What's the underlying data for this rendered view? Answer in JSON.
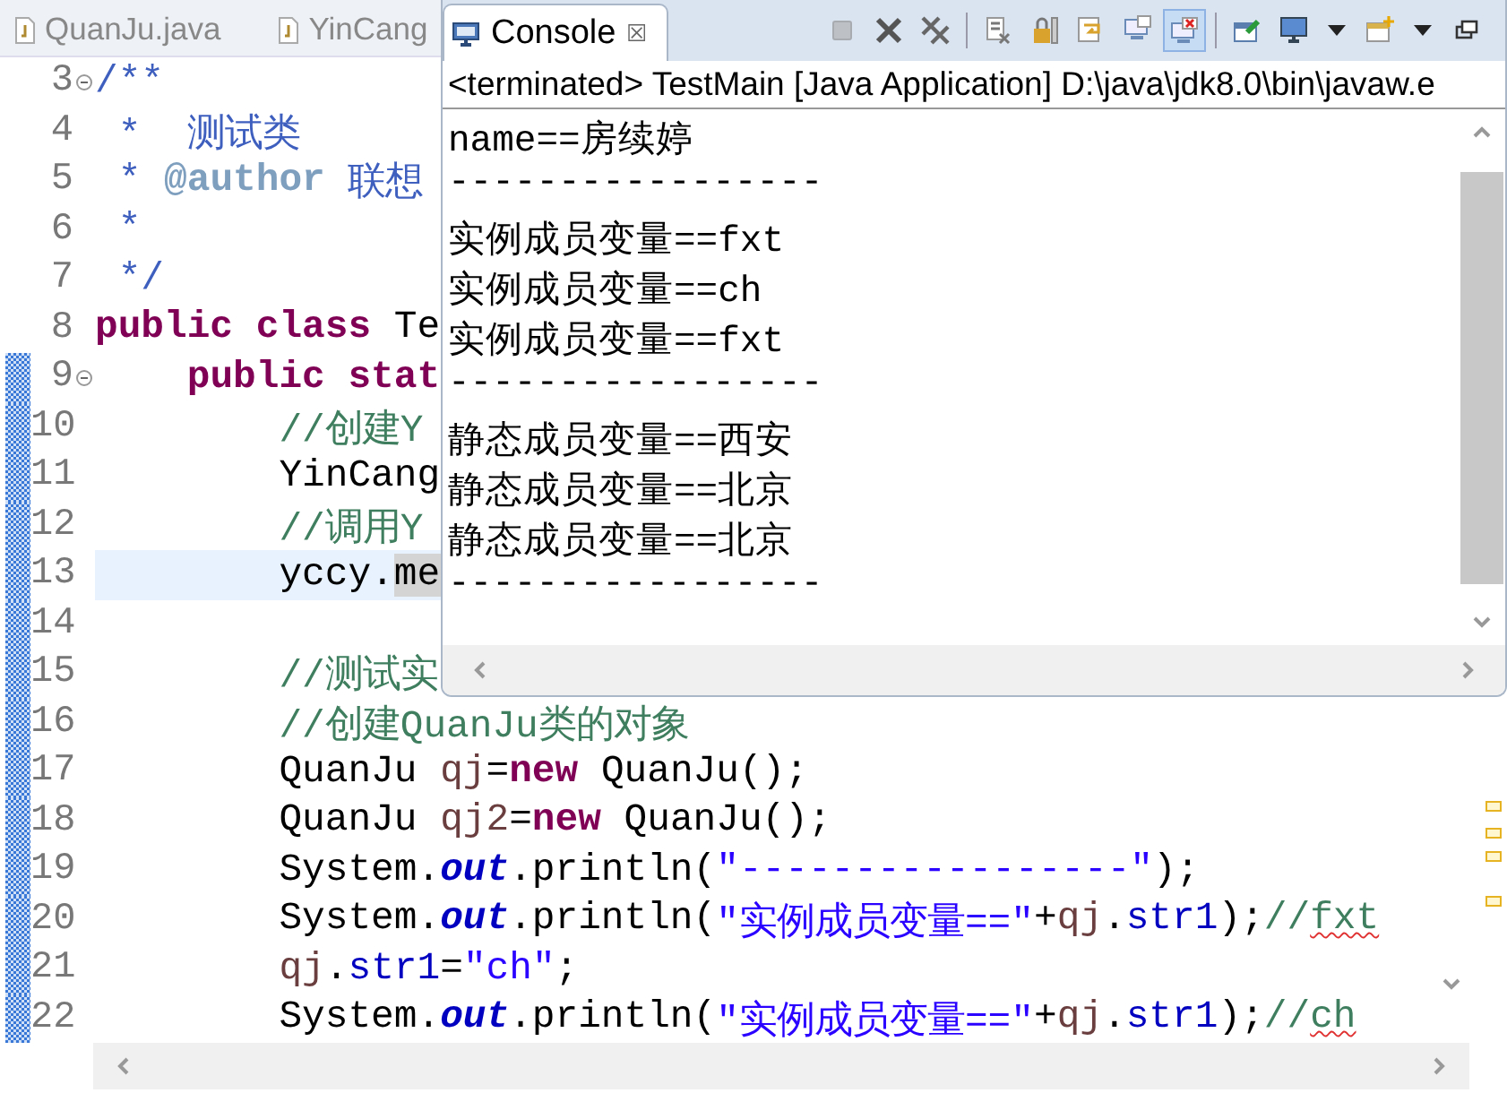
{
  "editor": {
    "tabs": [
      {
        "label": "QuanJu.java",
        "selected": false
      },
      {
        "label": "YinCang",
        "selected": false
      }
    ],
    "lines": [
      {
        "number": "3",
        "changed": false,
        "foldable": true,
        "current": false,
        "segments": [
          {
            "kind": "doc",
            "text": "/**"
          }
        ]
      },
      {
        "number": "4",
        "changed": false,
        "foldable": false,
        "current": false,
        "segments": [
          {
            "kind": "doc",
            "text": " *  测试类"
          }
        ]
      },
      {
        "number": "5",
        "changed": false,
        "foldable": false,
        "current": false,
        "segments": [
          {
            "kind": "doc",
            "text": " * "
          },
          {
            "kind": "doctag",
            "text": "@author"
          },
          {
            "kind": "doc",
            "text": " 联想"
          }
        ]
      },
      {
        "number": "6",
        "changed": false,
        "foldable": false,
        "current": false,
        "segments": [
          {
            "kind": "doc",
            "text": " *"
          }
        ]
      },
      {
        "number": "7",
        "changed": false,
        "foldable": false,
        "current": false,
        "segments": [
          {
            "kind": "doc",
            "text": " */"
          }
        ]
      },
      {
        "number": "8",
        "changed": false,
        "foldable": false,
        "current": false,
        "segments": [
          {
            "kind": "keyword",
            "text": "public class"
          },
          {
            "kind": "plain",
            "text": " Te"
          }
        ]
      },
      {
        "number": "9",
        "changed": true,
        "foldable": true,
        "current": false,
        "segments": [
          {
            "kind": "keyword",
            "text": "    public stat"
          }
        ]
      },
      {
        "number": "10",
        "changed": true,
        "foldable": false,
        "current": false,
        "segments": [
          {
            "kind": "comment",
            "text": "        //创建Y"
          }
        ]
      },
      {
        "number": "11",
        "changed": true,
        "foldable": false,
        "current": false,
        "segments": [
          {
            "kind": "plain",
            "text": "        YinCang"
          }
        ]
      },
      {
        "number": "12",
        "changed": true,
        "foldable": false,
        "current": false,
        "segments": [
          {
            "kind": "comment",
            "text": "        //调用Y"
          }
        ]
      },
      {
        "number": "13",
        "changed": true,
        "foldable": false,
        "current": true,
        "segments": [
          {
            "kind": "plain",
            "text": "        yccy."
          },
          {
            "kind": "occurrence",
            "text": "me"
          }
        ]
      },
      {
        "number": "14",
        "changed": true,
        "foldable": false,
        "current": false
      },
      {
        "number": "15",
        "changed": true,
        "foldable": false,
        "current": false,
        "segments": [
          {
            "kind": "comment",
            "text": "        //测试实"
          }
        ]
      },
      {
        "number": "16",
        "changed": true,
        "foldable": false,
        "current": false,
        "segments": [
          {
            "kind": "comment",
            "text": "        //创建QuanJu类的对象"
          }
        ]
      },
      {
        "number": "17",
        "changed": true,
        "foldable": false,
        "current": false,
        "segments": [
          {
            "kind": "plain",
            "text": "        QuanJu "
          },
          {
            "kind": "local",
            "text": "qj"
          },
          {
            "kind": "plain",
            "text": "="
          },
          {
            "kind": "keyword",
            "text": "new"
          },
          {
            "kind": "plain",
            "text": " QuanJu();"
          }
        ]
      },
      {
        "number": "18",
        "changed": true,
        "foldable": false,
        "current": false,
        "segments": [
          {
            "kind": "plain",
            "text": "        QuanJu "
          },
          {
            "kind": "local",
            "text": "qj2"
          },
          {
            "kind": "plain",
            "text": "="
          },
          {
            "kind": "keyword",
            "text": "new"
          },
          {
            "kind": "plain",
            "text": " QuanJu();"
          }
        ]
      },
      {
        "number": "19",
        "changed": true,
        "foldable": false,
        "current": false,
        "segments": [
          {
            "kind": "plain",
            "text": "        System."
          },
          {
            "kind": "static",
            "text": "out"
          },
          {
            "kind": "plain",
            "text": ".println("
          },
          {
            "kind": "string",
            "text": "\"-----------------\""
          },
          {
            "kind": "plain",
            "text": ");"
          }
        ]
      },
      {
        "number": "20",
        "changed": true,
        "foldable": false,
        "current": false,
        "segments": [
          {
            "kind": "plain",
            "text": "        System."
          },
          {
            "kind": "static",
            "text": "out"
          },
          {
            "kind": "plain",
            "text": ".println("
          },
          {
            "kind": "string",
            "text": "\"实例成员变量==\""
          },
          {
            "kind": "plain",
            "text": "+"
          },
          {
            "kind": "local",
            "text": "qj"
          },
          {
            "kind": "plain",
            "text": "."
          },
          {
            "kind": "field",
            "text": "str1"
          },
          {
            "kind": "plain",
            "text": ");"
          },
          {
            "kind": "comment",
            "text": "//"
          },
          {
            "kind": "misspelled",
            "text": "fxt"
          }
        ]
      },
      {
        "number": "21",
        "changed": true,
        "foldable": false,
        "current": false,
        "segments": [
          {
            "kind": "local",
            "text": "        qj"
          },
          {
            "kind": "plain",
            "text": "."
          },
          {
            "kind": "field",
            "text": "str1"
          },
          {
            "kind": "plain",
            "text": "="
          },
          {
            "kind": "string",
            "text": "\"ch\""
          },
          {
            "kind": "plain",
            "text": ";"
          }
        ]
      },
      {
        "number": "22",
        "changed": true,
        "foldable": false,
        "current": false,
        "segments": [
          {
            "kind": "plain",
            "text": "        System."
          },
          {
            "kind": "static",
            "text": "out"
          },
          {
            "kind": "plain",
            "text": ".println("
          },
          {
            "kind": "string",
            "text": "\"实例成员变量==\""
          },
          {
            "kind": "plain",
            "text": "+"
          },
          {
            "kind": "local",
            "text": "qj"
          },
          {
            "kind": "plain",
            "text": "."
          },
          {
            "kind": "field",
            "text": "str1"
          },
          {
            "kind": "plain",
            "text": ");"
          },
          {
            "kind": "comment",
            "text": "//"
          },
          {
            "kind": "misspelled",
            "text": "ch"
          }
        ]
      }
    ]
  },
  "console": {
    "tab": {
      "label": "Console",
      "close": "☒",
      "selected": true
    },
    "toolbar": [
      {
        "kind": "stop",
        "disabled": true,
        "selected": false
      },
      {
        "kind": "remove",
        "disabled": false,
        "selected": false
      },
      {
        "kind": "remove-all",
        "disabled": false,
        "selected": false
      },
      {
        "kind": "sep"
      },
      {
        "kind": "clear",
        "disabled": false,
        "selected": false
      },
      {
        "kind": "lock",
        "disabled": false,
        "selected": false
      },
      {
        "kind": "wrap",
        "disabled": false,
        "selected": false
      },
      {
        "kind": "show-out",
        "disabled": false,
        "selected": false
      },
      {
        "kind": "show-err",
        "disabled": false,
        "selected": true
      },
      {
        "kind": "sep"
      },
      {
        "kind": "pin",
        "disabled": false,
        "selected": false
      },
      {
        "kind": "display",
        "disabled": false,
        "selected": false
      },
      {
        "kind": "caret"
      },
      {
        "kind": "new",
        "disabled": false,
        "selected": false
      },
      {
        "kind": "caret"
      },
      {
        "kind": "minimize",
        "disabled": false,
        "selected": false
      }
    ],
    "status": "<terminated> TestMain [Java Application] D:\\java\\jdk8.0\\bin\\javaw.e",
    "output": [
      "name==房续婷",
      "-----------------",
      "实例成员变量==fxt",
      "实例成员变量==ch",
      "实例成员变量==fxt",
      "-----------------",
      "静态成员变量==西安",
      "静态成员变量==北京",
      "静态成员变量==北京",
      "-----------------"
    ]
  }
}
